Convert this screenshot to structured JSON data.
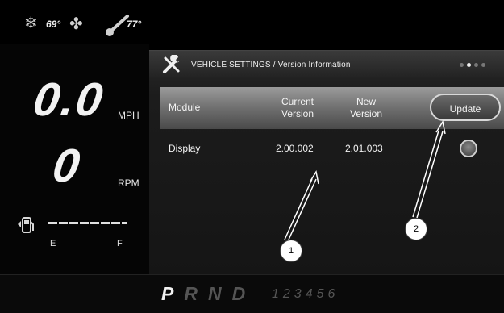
{
  "status": {
    "outside_temp": "69°",
    "inside_temp": "77°",
    "icons": [
      "snowflake-icon",
      "fan-icon",
      "thermometer-icon"
    ]
  },
  "cluster": {
    "speed": "0.0",
    "speed_unit": "MPH",
    "rpm": "0",
    "rpm_unit": "RPM",
    "fuel_empty": "E",
    "fuel_full": "F"
  },
  "settings": {
    "title": "VEHICLE SETTINGS / Version Information",
    "page_dots": 4,
    "active_dot": 1,
    "columns": {
      "module": "Module",
      "current": "Current Version",
      "new": "New Version",
      "update_button": "Update"
    },
    "rows": [
      {
        "module": "Display",
        "current": "2.00.002",
        "new": "2.01.003"
      }
    ]
  },
  "gear": {
    "letters": [
      "P",
      "R",
      "N",
      "D"
    ],
    "selected": "P",
    "numbers": "123456"
  },
  "callouts": [
    "1",
    "2"
  ],
  "colors": {
    "accent": "#d8d8d8",
    "background": "#000000"
  }
}
